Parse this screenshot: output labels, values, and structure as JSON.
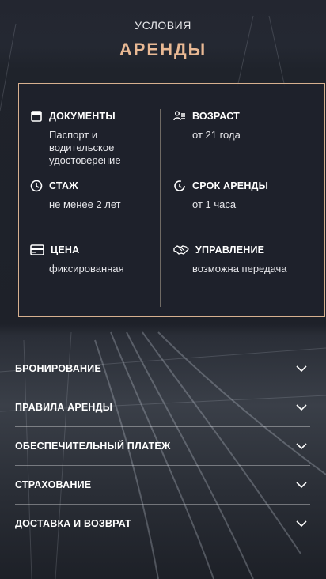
{
  "header": {
    "subtitle": "УСЛОВИЯ",
    "title": "АРЕНДЫ"
  },
  "conditions": [
    {
      "icon": "document-icon",
      "title": "ДОКУМЕНТЫ",
      "value": "Паспорт и водительское удостоверение"
    },
    {
      "icon": "age-icon",
      "title": "ВОЗРАСТ",
      "value": "от 21 года"
    },
    {
      "icon": "clock-icon",
      "title": "СТАЖ",
      "value": "не менее 2 лет"
    },
    {
      "icon": "timer-icon",
      "title": "СРОК АРЕНДЫ",
      "value": "от 1 часа"
    },
    {
      "icon": "card-icon",
      "title": "ЦЕНА",
      "value": "фиксированная"
    },
    {
      "icon": "handshake-icon",
      "title": "УПРАВЛЕНИЕ",
      "value": "возможна передача"
    }
  ],
  "accordion": [
    {
      "label": "БРОНИРОВАНИЕ"
    },
    {
      "label": "ПРАВИЛА АРЕНДЫ"
    },
    {
      "label": "ОБЕСПЕЧИТЕЛЬНЫЙ ПЛАТЕЖ"
    },
    {
      "label": "СТРАХОВАНИЕ"
    },
    {
      "label": "ДОСТАВКА И ВОЗВРАТ"
    }
  ],
  "colors": {
    "accent": "#e9b994",
    "card_border": "#d7b08f",
    "background": "#20232b"
  }
}
